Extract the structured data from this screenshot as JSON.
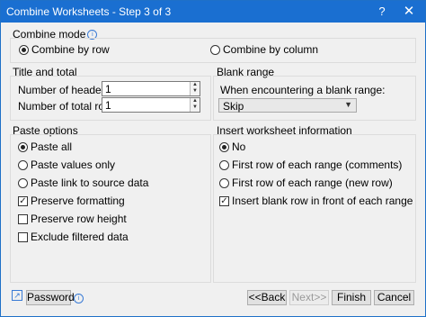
{
  "window": {
    "title": "Combine Worksheets - Step 3 of 3",
    "help": "?",
    "close": "✕"
  },
  "combine_mode": {
    "label": "Combine mode",
    "options": [
      {
        "label": "Combine by row",
        "selected": true
      },
      {
        "label": "Combine by column",
        "selected": false
      }
    ]
  },
  "title_total": {
    "label": "Title and total",
    "header_rows": {
      "label": "Number of header rows:",
      "value": "1"
    },
    "total_rows": {
      "label": "Number of total rows:",
      "value": "1"
    }
  },
  "blank_range": {
    "label": "Blank range",
    "prompt": "When encountering a blank range:",
    "selected": "Skip"
  },
  "paste_options": {
    "label": "Paste options",
    "radios": [
      {
        "label": "Paste all",
        "selected": true
      },
      {
        "label": "Paste values only",
        "selected": false
      },
      {
        "label": "Paste link to source data",
        "selected": false
      }
    ],
    "checks": [
      {
        "label": "Preserve formatting",
        "checked": true
      },
      {
        "label": "Preserve row height",
        "checked": false
      },
      {
        "label": "Exclude filtered data",
        "checked": false
      }
    ]
  },
  "insert_info": {
    "label": "Insert worksheet information",
    "radios": [
      {
        "label": "No",
        "selected": true
      },
      {
        "label": "First row of each range (comments)",
        "selected": false
      },
      {
        "label": "First row of each range (new row)",
        "selected": false
      }
    ],
    "check": {
      "label": "Insert blank row in front of each range",
      "checked": true
    }
  },
  "footer": {
    "password": "Password",
    "back": "<<Back",
    "next": "Next>>",
    "finish": "Finish",
    "cancel": "Cancel"
  }
}
